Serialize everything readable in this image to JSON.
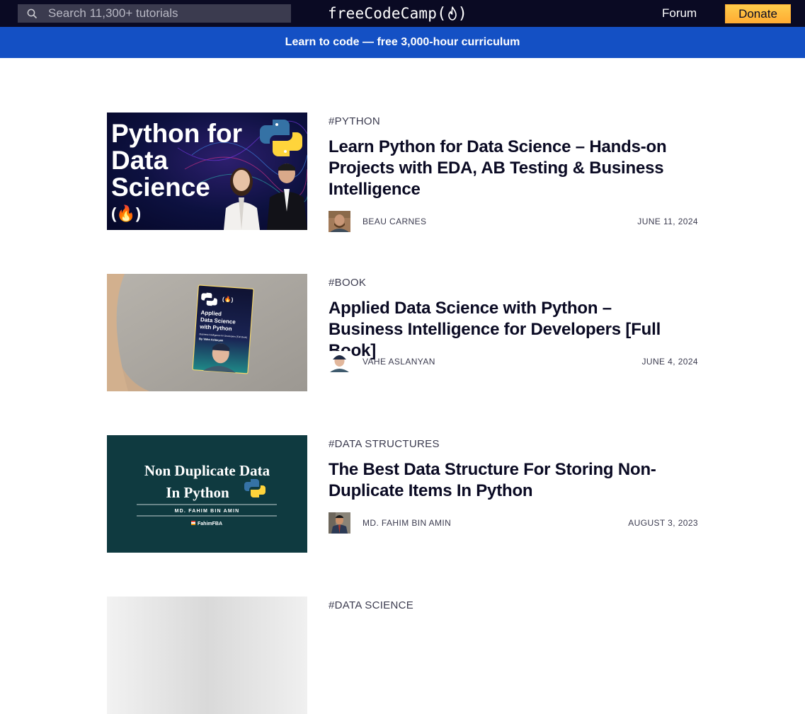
{
  "nav": {
    "search_placeholder": "Search 11,300+ tutorials",
    "logo_text_left": "freeCodeCamp",
    "logo_paren_open": "(",
    "logo_paren_close": ")",
    "forum_label": "Forum",
    "donate_label": "Donate"
  },
  "banner": {
    "text": "Learn to code — free 3,000-hour curriculum"
  },
  "colors": {
    "nav_bg": "#0a0a23",
    "banner_bg": "#1450c4",
    "donate_bg": "#feac32",
    "text": "#0a0a23",
    "muted": "#3b3b4f"
  },
  "articles": [
    {
      "tag": "#PYTHON",
      "title": "Learn Python for Data Science – Hands-on Projects with EDA, AB Testing & Business Intelligence",
      "author": "BEAU CARNES",
      "date": "JUNE 11, 2024",
      "thumbnail": {
        "line1": "Python for",
        "line2": "Data",
        "line3": "Science",
        "badge": "(🔥)"
      }
    },
    {
      "tag": "#BOOK",
      "title": "Applied Data Science with Python – Business Intelligence for Developers [Full Book]",
      "author": "VAHE ASLANYAN",
      "date": "JUNE 4, 2024",
      "thumbnail": {
        "book_title_1": "Applied",
        "book_title_2": "Data Science",
        "book_title_3": "with Python",
        "book_sub": "Business Intelligence for Developers [Full Book]",
        "book_author": "By Vahe Aslanyan"
      }
    },
    {
      "tag": "#DATA STRUCTURES",
      "title": "The Best Data Structure For Storing Non-Duplicate Items In Python",
      "author": "MD. FAHIM BIN AMIN",
      "date": "AUGUST 3, 2023",
      "thumbnail": {
        "line1": "Non Duplicate Data",
        "line2": "In Python",
        "byline": "MD. FAHIM BIN AMIN",
        "handle": "FahimFBA"
      }
    },
    {
      "tag": "#DATA SCIENCE"
    }
  ]
}
